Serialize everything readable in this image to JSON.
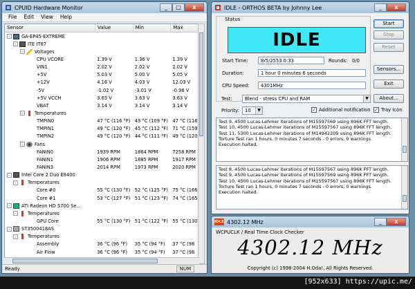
{
  "hwmon": {
    "title": "CPUID Hardware Monitor",
    "menu": [
      "File",
      "Edit",
      "View",
      "Help"
    ],
    "columns": [
      "Sensor",
      "Value",
      "Min",
      "Max"
    ],
    "rows": [
      {
        "lvl": 0,
        "exp": "-",
        "icon": "pc",
        "label": "GA-EP45-EXTREME",
        "v": "",
        "mn": "",
        "mx": ""
      },
      {
        "lvl": 1,
        "exp": "-",
        "icon": "chip",
        "label": "ITE IT87",
        "v": "",
        "mn": "",
        "mx": ""
      },
      {
        "lvl": 2,
        "exp": "-",
        "icon": "volt",
        "label": "Voltages",
        "v": "",
        "mn": "",
        "mx": ""
      },
      {
        "lvl": 3,
        "exp": "",
        "icon": "",
        "label": "CPU VCORE",
        "v": "1.39 V",
        "mn": "1.36 V",
        "mx": "1.39 V"
      },
      {
        "lvl": 3,
        "exp": "",
        "icon": "",
        "label": "VIN1",
        "v": "2.02 V",
        "mn": "2.02 V",
        "mx": "2.02 V"
      },
      {
        "lvl": 3,
        "exp": "",
        "icon": "",
        "label": "+5V",
        "v": "5.03 V",
        "mn": "5.00 V",
        "mx": "5.05 V"
      },
      {
        "lvl": 3,
        "exp": "",
        "icon": "",
        "label": "+12V",
        "v": "4.16 V",
        "mn": "4.03 V",
        "mx": "12.03 V"
      },
      {
        "lvl": 3,
        "exp": "",
        "icon": "",
        "label": "-5V",
        "v": "-1.02 V",
        "mn": "-3.01 V",
        "mx": "-0.96 V"
      },
      {
        "lvl": 3,
        "exp": "",
        "icon": "",
        "label": "+5V VCCH",
        "v": "3.63 V",
        "mn": "3.63 V",
        "mx": "3.63 V"
      },
      {
        "lvl": 3,
        "exp": "",
        "icon": "",
        "label": "VBAT",
        "v": "3.14 V",
        "mn": "3.14 V",
        "mx": "3.14 V"
      },
      {
        "lvl": 2,
        "exp": "-",
        "icon": "therm",
        "label": "Temperatures",
        "v": "",
        "mn": "",
        "mx": ""
      },
      {
        "lvl": 3,
        "exp": "",
        "icon": "",
        "label": "TMPIN0",
        "v": "47 °C  (116 °F)",
        "mn": "43 °C  (109 °F)",
        "mx": "47 °C  (116"
      },
      {
        "lvl": 3,
        "exp": "",
        "icon": "",
        "label": "TMPIN1",
        "v": "49 °C  (120 °F)",
        "mn": "45 °C  (112 °F)",
        "mx": "71 °C  (159"
      },
      {
        "lvl": 3,
        "exp": "",
        "icon": "",
        "label": "TMPIN2",
        "v": "49 °C  (120 °F)",
        "mn": "44 °C  (111 °F)",
        "mx": "49 °C  (120"
      },
      {
        "lvl": 2,
        "exp": "-",
        "icon": "fan",
        "label": "Fans",
        "v": "",
        "mn": "",
        "mx": ""
      },
      {
        "lvl": 3,
        "exp": "",
        "icon": "",
        "label": "FANIN0",
        "v": "1939 RPM",
        "mn": "1864 RPM",
        "mx": "7258 RPM"
      },
      {
        "lvl": 3,
        "exp": "",
        "icon": "",
        "label": "FANIN1",
        "v": "1906 RPM",
        "mn": "1885 RPM",
        "mx": "1917 RPM"
      },
      {
        "lvl": 3,
        "exp": "",
        "icon": "",
        "label": "FANIN3",
        "v": "2014 RPM",
        "mn": "1973 RPM",
        "mx": "2020 RPM"
      },
      {
        "lvl": 0,
        "exp": "-",
        "icon": "chip",
        "label": "Intel Core 2 Duo E8400",
        "v": "",
        "mn": "",
        "mx": ""
      },
      {
        "lvl": 1,
        "exp": "-",
        "icon": "therm",
        "label": "Temperatures",
        "v": "",
        "mn": "",
        "mx": ""
      },
      {
        "lvl": 3,
        "exp": "",
        "icon": "",
        "label": "Core #0",
        "v": "55 °C  (130 °F)",
        "mn": "52 °C  (125 °F)",
        "mx": "75 °C  (166"
      },
      {
        "lvl": 3,
        "exp": "",
        "icon": "",
        "label": "Core #1",
        "v": "53 °C  (127 °F)",
        "mn": "51 °C  (123 °F)",
        "mx": "74 °C  (165"
      },
      {
        "lvl": 0,
        "exp": "-",
        "icon": "gpu",
        "label": "ATI Radeon HD 5700 Se...",
        "v": "",
        "mn": "",
        "mx": ""
      },
      {
        "lvl": 1,
        "exp": "-",
        "icon": "therm",
        "label": "Temperatures",
        "v": "",
        "mn": "",
        "mx": ""
      },
      {
        "lvl": 3,
        "exp": "",
        "icon": "",
        "label": "GPU Core",
        "v": "55 °C  (130 °F)",
        "mn": "51 °C  (122 °F)",
        "mx": "55 °C  (130"
      },
      {
        "lvl": 0,
        "exp": "-",
        "icon": "hdd",
        "label": "ST3500418AS",
        "v": "",
        "mn": "",
        "mx": ""
      },
      {
        "lvl": 1,
        "exp": "-",
        "icon": "therm",
        "label": "Temperatures",
        "v": "",
        "mn": "",
        "mx": ""
      },
      {
        "lvl": 3,
        "exp": "",
        "icon": "",
        "label": "Assembly",
        "v": "36 °C  (96 °F)",
        "mn": "35 °C  (94 °F)",
        "mx": "37 °C  (98"
      },
      {
        "lvl": 3,
        "exp": "",
        "icon": "",
        "label": "Air Flow",
        "v": "36 °C  (96 °F)",
        "mn": "35 °C  (94 °F)",
        "mx": "37 °C  (98"
      }
    ],
    "status": "Ready",
    "num": "NUM"
  },
  "orthos": {
    "title": "IDLE - ORTHOS BETA by Johnny Lee",
    "status_group": "Status",
    "state": "IDLE",
    "start_time_label": "Start Time:",
    "start_time": "8/5/2553 0:33",
    "rounds_label": "Rounds:",
    "rounds": "0/0",
    "duration_label": "Duration:",
    "duration": "1 hour 0 minutes 6 seconds",
    "cpu_speed_label": "CPU Speed:",
    "cpu_speed": "4301MHz",
    "test_label": "Test:",
    "test_value": "Blend - stress CPU and RAM",
    "priority_label": "Priority:",
    "priority_value": "10",
    "additional_notification": "Additional notification",
    "tray_icon": "Tray Icon",
    "buttons": {
      "start": "Start",
      "stop": "Stop",
      "reset": "Reset",
      "sensors": "Sensors...",
      "exit": "Exit",
      "about": "About..."
    },
    "log1": [
      "Test 9, 4500 Lucas-Lehmer iterations of M15597569 using 896K FFT length.",
      "Test 10, 4500 Lucas-Lehmer iterations of M15597567 using 896K FFT length.",
      "Test 11, 5300 Lucas-Lehmer iterations of M14942209 using 896K FFT length.",
      "Torture Test ran 1 hours, 0 minutes 7 seconds - 0 errors, 0 warnings.",
      "Execution halted."
    ],
    "log2": [
      "Test 8, 4500 Lucas-Lehmer iterations of M15597567 using 896K FFT length.",
      "Test 9, 4500 Lucas-Lehmer iterations of M15597569 using 896K FFT length.",
      "Test 10, 4500 Lucas-Lehmer iterations of M15597567 using 896K FFT length.",
      "Torture Test ran 1 hours, 0 minutes 7 seconds - 0 errors, 0 warnings.",
      "Execution halted."
    ]
  },
  "clock": {
    "title": "4302.12 MHz",
    "logo_text": "IDLE",
    "subtitle": "WCPUCLK / Real Time Clock Checker",
    "value": "4302.12 MHz",
    "copyright": "Copyright (c) 1998-2004 H.Oda!,  All Rights Reserved."
  },
  "watermark": "[952x633] https://upic.me/"
}
